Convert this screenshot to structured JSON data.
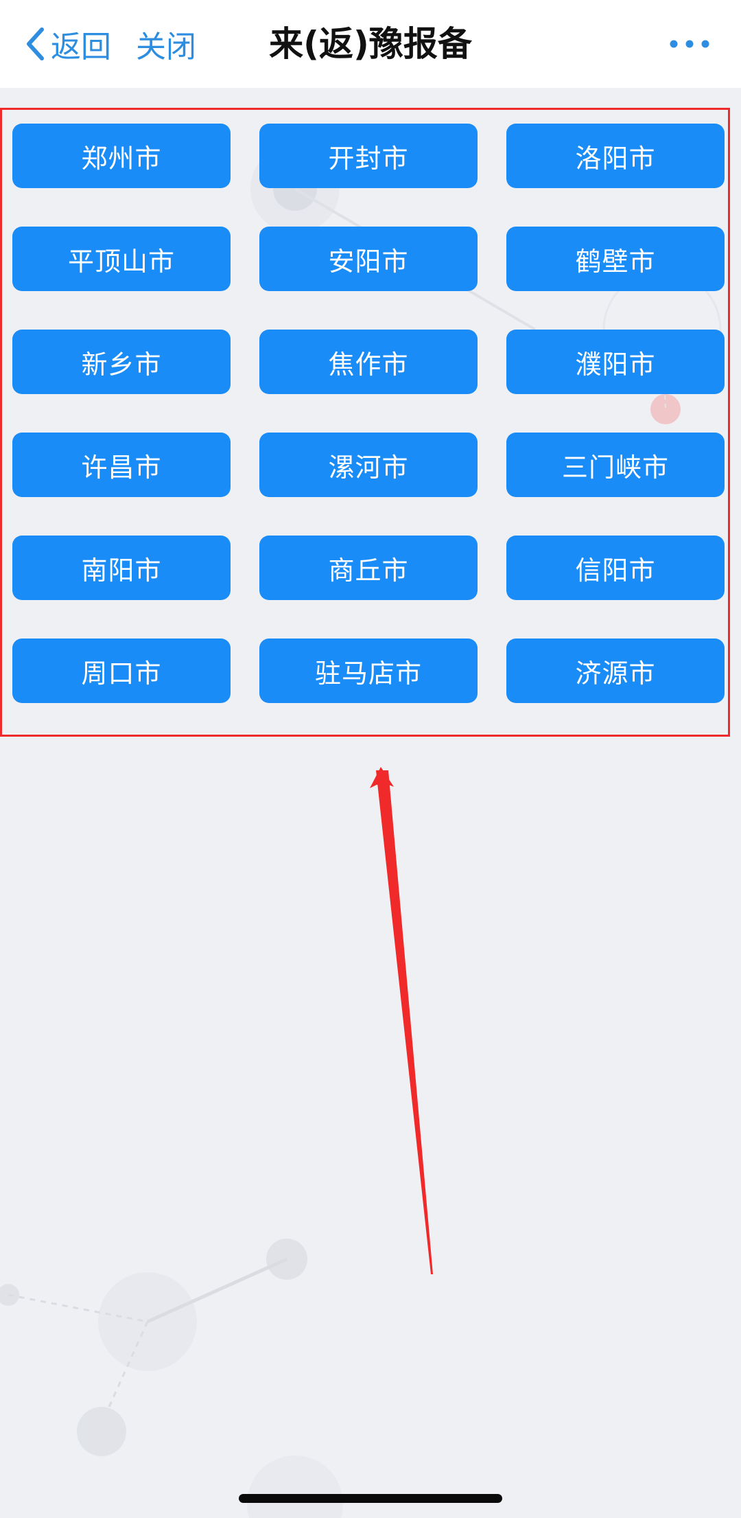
{
  "nav": {
    "back_label": "返回",
    "close_label": "关闭",
    "title": "来(返)豫报备"
  },
  "cities": [
    "郑州市",
    "开封市",
    "洛阳市",
    "平顶山市",
    "安阳市",
    "鹤壁市",
    "新乡市",
    "焦作市",
    "濮阳市",
    "许昌市",
    "漯河市",
    "三门峡市",
    "南阳市",
    "商丘市",
    "信阳市",
    "周口市",
    "驻马店市",
    "济源市"
  ],
  "colors": {
    "accent": "#2d8de0",
    "button": "#1a8cf8",
    "highlight": "#f02a2a",
    "background": "#eff0f4"
  },
  "icons": {
    "back": "chevron-left-icon",
    "more": "more-horizontal-icon"
  }
}
